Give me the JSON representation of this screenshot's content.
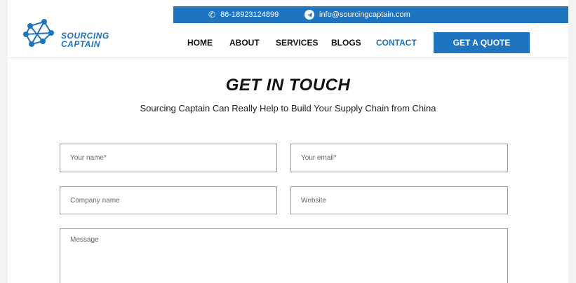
{
  "topbar": {
    "phone": "86-18923124899",
    "email": "info@sourcingcaptain.com",
    "phone_icon": "phone-icon",
    "email_icon": "telegram-icon"
  },
  "logo": {
    "line1": "SOURCING",
    "line2": "CAPTAIN"
  },
  "nav": {
    "home": "HOME",
    "about": "ABOUT",
    "services": "SERVICES",
    "blogs": "BLOGS",
    "contact": "CONTACT",
    "quote_button": "GET A QUOTE"
  },
  "contact": {
    "title": "GET IN TOUCH",
    "subtitle": "Sourcing Captain Can Really Help to Build Your Supply Chain from China"
  },
  "form": {
    "name_placeholder": "Your name*",
    "email_placeholder": "Your email*",
    "company_placeholder": "Company name",
    "website_placeholder": "Website",
    "message_placeholder": "Message"
  },
  "colors": {
    "brand_blue": "#1f74bf",
    "page_bg": "#f2f2f2"
  }
}
